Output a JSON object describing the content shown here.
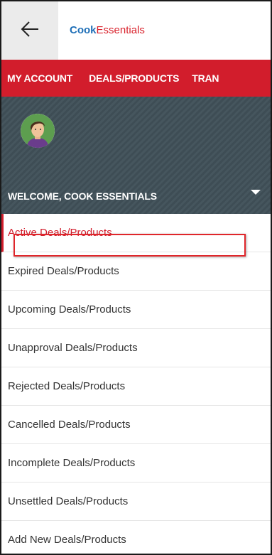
{
  "header": {
    "back_icon": "arrow-left-icon",
    "brand_part1": "Cook",
    "brand_part2": "Essentials"
  },
  "nav": {
    "items": [
      {
        "label": "MY ACCOUNT"
      },
      {
        "label": "DEALS/PRODUCTS"
      },
      {
        "label": "TRAN"
      }
    ]
  },
  "profile": {
    "avatar_icon": "user-avatar-icon",
    "welcome": "WELCOME, COOK ESSENTIALS",
    "caret_icon": "caret-down-icon"
  },
  "menu": {
    "items": [
      {
        "label": "Active Deals/Products",
        "active": true
      },
      {
        "label": "Expired Deals/Products",
        "highlighted": true
      },
      {
        "label": "Upcoming Deals/Products"
      },
      {
        "label": "Unapproval Deals/Products"
      },
      {
        "label": "Rejected Deals/Products"
      },
      {
        "label": "Cancelled Deals/Products"
      },
      {
        "label": "Incomplete Deals/Products"
      },
      {
        "label": "Unsettled Deals/Products"
      },
      {
        "label": "Add New Deals/Products"
      }
    ]
  },
  "colors": {
    "accent_red": "#d21d2c",
    "brand_blue": "#1f6fb7",
    "panel_dark": "#3e4d55",
    "highlight_red": "#e0262b"
  }
}
